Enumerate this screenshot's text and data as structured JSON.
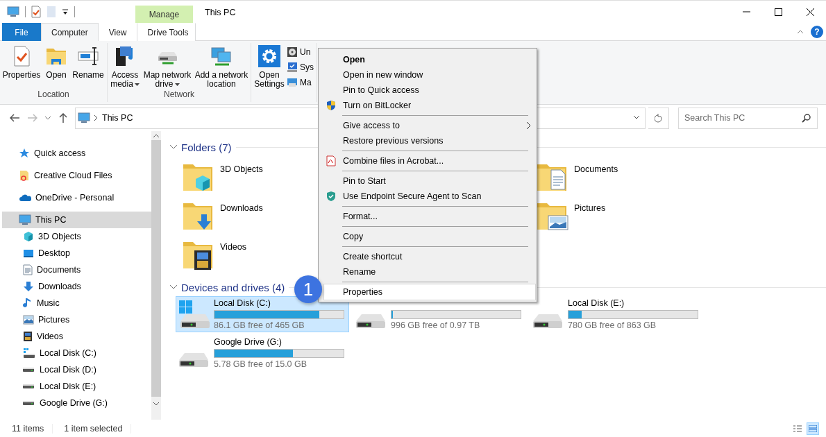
{
  "window": {
    "title": "This PC",
    "help_label": "?"
  },
  "ribbon": {
    "context_header": "Manage",
    "tabs": [
      {
        "label": "File",
        "kind": "file",
        "selected": false
      },
      {
        "label": "Computer",
        "kind": "tab",
        "selected": true
      },
      {
        "label": "View",
        "kind": "tab",
        "selected": false
      },
      {
        "label": "Drive Tools",
        "kind": "context",
        "selected": false
      }
    ],
    "groups": [
      {
        "label": "Location",
        "buttons": [
          {
            "label": "Properties",
            "kind": "properties"
          },
          {
            "label": "Open",
            "kind": "open"
          },
          {
            "label": "Rename",
            "kind": "rename"
          }
        ]
      },
      {
        "label": "Network",
        "buttons": [
          {
            "label": "Access media",
            "kind": "media",
            "dropdown": true
          },
          {
            "label": "Map network drive",
            "kind": "mapdrive",
            "dropdown": true
          },
          {
            "label": "Add a network location",
            "kind": "netloc",
            "dropdown": false
          }
        ]
      },
      {
        "buttons": [
          {
            "label": "Open Settings",
            "kind": "settings",
            "dropdown": false
          }
        ],
        "small_buttons": [
          {
            "label": "Un",
            "kind": "uninstall"
          },
          {
            "label": "Sys",
            "kind": "system"
          },
          {
            "label": "Ma",
            "kind": "manage"
          }
        ]
      }
    ]
  },
  "address": {
    "path": "This PC"
  },
  "search": {
    "placeholder": "Search This PC"
  },
  "navigation": [
    {
      "label": "Quick access",
      "kind": "quick",
      "selected": false
    },
    {
      "label": "Creative Cloud Files",
      "kind": "cloudfiles",
      "selected": false
    },
    {
      "label": "OneDrive - Personal",
      "kind": "onedrive",
      "selected": false
    },
    {
      "label": "This PC",
      "kind": "pc",
      "selected": true,
      "children": [
        {
          "label": "3D Objects",
          "kind": "objects3d",
          "selected": false
        },
        {
          "label": "Desktop",
          "kind": "desktop",
          "selected": false
        },
        {
          "label": "Documents",
          "kind": "documents",
          "selected": false
        },
        {
          "label": "Downloads",
          "kind": "downloads",
          "selected": false
        },
        {
          "label": "Music",
          "kind": "music",
          "selected": false
        },
        {
          "label": "Pictures",
          "kind": "pictures",
          "selected": false
        },
        {
          "label": "Videos",
          "kind": "videos",
          "selected": false
        },
        {
          "label": "Local Disk (C:)",
          "kind": "windrive",
          "selected": false
        },
        {
          "label": "Local Disk (D:)",
          "kind": "drive",
          "selected": false
        },
        {
          "label": "Local Disk (E:)",
          "kind": "drive",
          "selected": false
        },
        {
          "label": "Google Drive (G:)",
          "kind": "drive",
          "selected": false
        }
      ]
    }
  ],
  "folders": {
    "heading": "Folders (7)",
    "items": [
      {
        "label": "3D Objects",
        "kind": "objects3d"
      },
      {
        "label": "Documents",
        "kind": "documents"
      },
      {
        "label": "Downloads",
        "kind": "downloads"
      },
      {
        "label": "Pictures",
        "kind": "pictures"
      },
      {
        "label": "Videos",
        "kind": "videos"
      }
    ]
  },
  "drives": {
    "heading": "Devices and drives (4)",
    "items": [
      {
        "label": "Local Disk (C:)",
        "kind": "windrive",
        "level": 0.81,
        "free": "86.1 GB free of 465 GB",
        "selected": true
      },
      {
        "kind": "drive",
        "level": 0.01,
        "free": "996 GB free of 0.97 TB",
        "selected": false
      },
      {
        "label": "Local Disk (E:)",
        "kind": "drive",
        "level": 0.1,
        "free": "780 GB free of 863 GB",
        "selected": false
      },
      {
        "label": "Google Drive (G:)",
        "kind": "drive",
        "level": 0.61,
        "free": "5.78 GB free of 15.0 GB",
        "selected": false
      }
    ]
  },
  "context_menu": {
    "groups": [
      [
        {
          "label": "Open",
          "kind": "default",
          "selected": false
        },
        {
          "label": "Open in new window",
          "kind": "plain",
          "selected": false
        },
        {
          "label": "Pin to Quick access",
          "kind": "plain",
          "selected": false
        },
        {
          "label": "Turn on BitLocker",
          "kind": "shield",
          "selected": false
        }
      ],
      [
        {
          "label": "Give access to",
          "kind": "submenu",
          "selected": false
        },
        {
          "label": "Restore previous versions",
          "kind": "plain",
          "selected": false
        }
      ],
      [
        {
          "label": "Combine files in Acrobat...",
          "kind": "pdf",
          "selected": false
        }
      ],
      [
        {
          "label": "Pin to Start",
          "kind": "plain",
          "selected": false
        },
        {
          "label": "Use Endpoint Secure Agent to Scan",
          "kind": "scan",
          "selected": false
        }
      ],
      [
        {
          "label": "Format...",
          "kind": "plain",
          "selected": false
        }
      ],
      [
        {
          "label": "Copy",
          "kind": "plain",
          "selected": false
        }
      ],
      [
        {
          "label": "Create shortcut",
          "kind": "plain",
          "selected": false
        },
        {
          "label": "Rename",
          "kind": "plain",
          "selected": false
        }
      ],
      [
        {
          "label": "Properties",
          "kind": "plain",
          "selected": true
        }
      ]
    ]
  },
  "step_badge": "1",
  "status_bar": {
    "items_count": "11 items",
    "selection": "1 item selected"
  }
}
